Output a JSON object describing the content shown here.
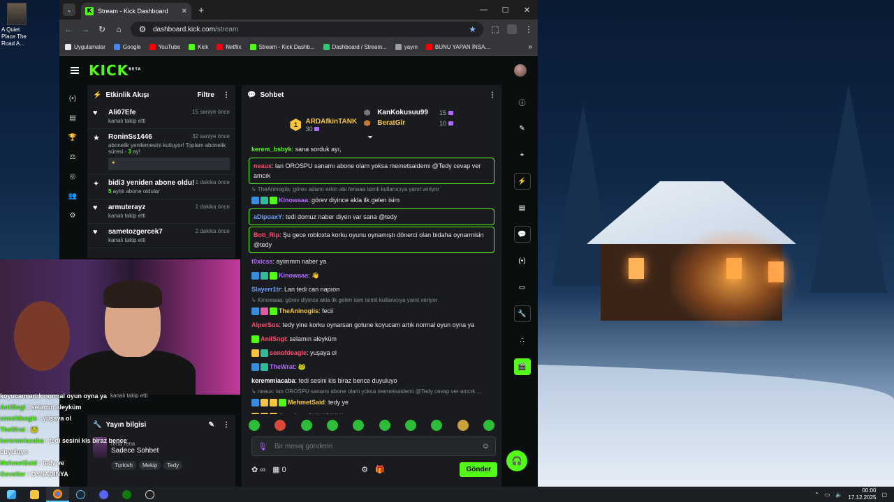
{
  "desktop": {
    "icon_label": "A Quiet Place The Road A..."
  },
  "browser": {
    "tab_title": "Stream - Kick Dashboard",
    "url_host": "dashboard.kick.com",
    "url_path": "/stream",
    "bookmarks": [
      {
        "label": "Uygulamalar",
        "color": "#e8eaed"
      },
      {
        "label": "Google",
        "color": "#4285f4"
      },
      {
        "label": "YouTube",
        "color": "#ff0000"
      },
      {
        "label": "Kick",
        "color": "#53fc18"
      },
      {
        "label": "Netflix",
        "color": "#e50914"
      },
      {
        "label": "Stream - Kick Dashb...",
        "color": "#53fc18"
      },
      {
        "label": "Dashboard / Stream...",
        "color": "#2ecc71"
      },
      {
        "label": "yayın",
        "color": "#9aa0a6"
      },
      {
        "label": "BUNU YAPAN İNSA...",
        "color": "#ff0000"
      }
    ]
  },
  "kick": {
    "logo": "KICK",
    "logo_beta": "BETA",
    "activity": {
      "title": "Etkinlik Akışı",
      "filter_label": "Filtre",
      "items": [
        {
          "icon": "heart-icon",
          "glyph": "♥",
          "name": "Ali07Efe",
          "time": "15 saniye önce",
          "sub": "kanalı takip etti"
        },
        {
          "icon": "star-icon",
          "glyph": "★",
          "name": "RoninSs1446",
          "time": "32 saniye önce",
          "sub": "abonelik yenilemesini kutluyor! Toplam abonelik süresi - ",
          "sub_strong": "3",
          "sub_tail": " ay!",
          "bar": "✦"
        },
        {
          "icon": "sparkle-icon",
          "glyph": "✦",
          "name": "bidi3 yeniden abone oldu!",
          "time": "1 dakika önce",
          "sub_strong": "5",
          "sub": "",
          "sub_tail": " aylık abone oldular"
        },
        {
          "icon": "heart-icon",
          "glyph": "♥",
          "name": "armuterayz",
          "time": "1 dakika önce",
          "sub": "kanalı takip etti"
        },
        {
          "icon": "heart-icon",
          "glyph": "♥",
          "name": "sametozgercek7",
          "time": "2 dakika önce",
          "sub": "kanalı takip etti"
        }
      ],
      "hidden_sub": "kanalı takip etti"
    },
    "info": {
      "title": "Yayın bilgisi",
      "partial_text": "rena rena",
      "category": "Sadece Sohbet",
      "tags": [
        "Turkish",
        "Mekip",
        "Tedy"
      ]
    },
    "chat": {
      "title": "Sohbet",
      "leader1": {
        "rank": "1",
        "name": "ARDAfkinTANK",
        "count": "30",
        "color": "#f5c542"
      },
      "leader2": {
        "name": "KanKokusuu99",
        "count": "15",
        "color": "#ffffff"
      },
      "leader3": {
        "name": "BeratGlr",
        "count": "10",
        "color": "#f5c542"
      },
      "messages": [
        {
          "type": "msg",
          "user": "kerem_bsbyk",
          "color": "#53fc18",
          "text": "sana sorduk ayı,"
        },
        {
          "type": "hl",
          "user": "neaux",
          "color": "#ff4d6d",
          "text": "lan OROSPU sanamı abone olam yoksa memetsaidemi @Tedy cevap ver amcık"
        },
        {
          "type": "reply",
          "text": "↳ TheAninogiis: görev adamı erkin abi fenaaa isimli kullanıcıya yanıt veriyor"
        },
        {
          "type": "msg",
          "user": "Kinowaaa",
          "color": "#b36bff",
          "text": "görev diyince akla ilk gelen isim",
          "badges": [
            "#3a8dde",
            "#2dbd9a",
            "#53fc18"
          ]
        },
        {
          "type": "hl",
          "user": "aDipoaxY",
          "color": "#6aa2ff",
          "text": "tedi domuz naber diyen var sana @tedy"
        },
        {
          "type": "hl",
          "user": "Boti_Rip",
          "color": "#ff4d6d",
          "text": "Şu gece robloxta korku oyunu oynamıştı dönerci olan bidaha oynarmisin @tedy"
        },
        {
          "type": "msg",
          "user": "t0xicss",
          "color": "#b36bff",
          "text": "ayimmm naber ya"
        },
        {
          "type": "msg",
          "user": "Kinowaaa",
          "color": "#b36bff",
          "text": "👋",
          "badges": [
            "#3a8dde",
            "#2dbd9a",
            "#53fc18"
          ]
        },
        {
          "type": "msg",
          "user": "Slayerr1tr",
          "color": "#6aa2ff",
          "text": "Lan tedi can napıon"
        },
        {
          "type": "reply",
          "text": "↳ Kinowaaa: görev diyince akla ilk gelen isim isimli kullanıcıya yanıt veriyor"
        },
        {
          "type": "msg",
          "user": "TheAninogiis",
          "color": "#f5c542",
          "text": "fecii",
          "badges": [
            "#3a8dde",
            "#e05aa8",
            "#53fc18"
          ]
        },
        {
          "type": "msg",
          "user": "AlperSos",
          "color": "#ff4d6d",
          "text": "tedy yine korku oynarsan gotune koyucam artık normal oyun oyna ya"
        },
        {
          "type": "msg",
          "user": "AniISngi",
          "color": "#ff4d6d",
          "text": "selamın aleyküm",
          "badges": [
            "#53fc18"
          ]
        },
        {
          "type": "msg",
          "user": "sonofdeagle",
          "color": "#ff4d6d",
          "text": "yuşaya ol",
          "badges": [
            "#f5c542",
            "#2dbd9a"
          ]
        },
        {
          "type": "msg",
          "user": "TheWrat",
          "color": "#b36bff",
          "text": "🐸",
          "badges": [
            "#3a8dde",
            "#2dbd9a"
          ]
        },
        {
          "type": "msg",
          "user": "keremmiacaba",
          "color": "#ffffff",
          "text": "tedi sesini kis biraz bence duyuluyo"
        },
        {
          "type": "reply",
          "text": "↳ neaux: lan OROSPU sanamı abone olam yoksa memetsaidemi @Tedy cevap ver amcık ..."
        },
        {
          "type": "msg",
          "user": "MehmetSaid",
          "color": "#f5c542",
          "text": "tedy ye",
          "badges": [
            "#3a8dde",
            "#f5c542",
            "#f5c542",
            "#53fc18"
          ]
        },
        {
          "type": "msg",
          "user": "Gevolter",
          "color": "#f5c542",
          "text": "OYNADINYA",
          "badges": [
            "#f5c542",
            "#f5c542",
            "#f5c542"
          ]
        }
      ],
      "input_placeholder": "Bir mesaj gönderin",
      "points": "∞",
      "count": "0",
      "send_label": "Gönder"
    }
  },
  "overlay_chat": [
    {
      "user": "",
      "text": "koyucam artık normal oyun oyna ya"
    },
    {
      "user": "AniISngi",
      "text": " : selamın aleyküm"
    },
    {
      "user": "sonofdeagle",
      "text": " : yuşaya ol"
    },
    {
      "user": "TheWrat",
      "text": " : 🐸"
    },
    {
      "user": "keremmiacaba",
      "text": " : tedi sesini kis biraz bence duyuluyo"
    },
    {
      "user": "MehmetSaid",
      "text": " : tedy ye"
    },
    {
      "user": "Gevolter",
      "text": " : OYNADINYA"
    }
  ],
  "taskbar": {
    "time": "00:00",
    "date": "17.12.2025"
  }
}
